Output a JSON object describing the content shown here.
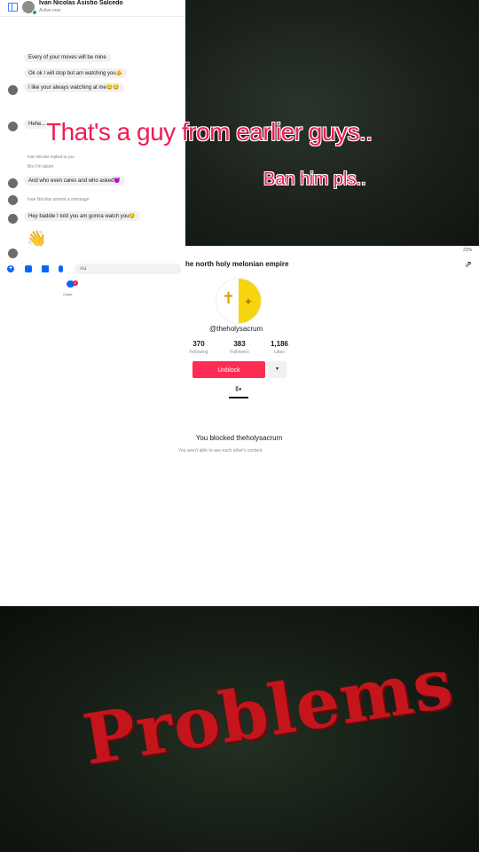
{
  "messenger": {
    "contact_name": "Ivan Nicolas Asistio Salcedo",
    "contact_status": "Active now",
    "messages": [
      "Every of your moves will be mine",
      "Ok ok I will stop but am watching you🫵",
      "I like your always watching at me😏😏",
      "Hehe...",
      "Bro I'm taken",
      "And who even cares and who asked😈",
      "Hey baddie I told you am gonna watch you😏"
    ],
    "reply_label": "Ivan Nicolas replied to you",
    "system_note": "Ivan Nicolas unsent a message",
    "wave": "👋",
    "composer_placeholder": "Aa",
    "chats_label": "Chats",
    "chats_badge": "2"
  },
  "captions": {
    "main": "That's a guy from earlier guys..",
    "sub": "Ban him pls.."
  },
  "profile": {
    "status_bar": "22%",
    "display_name": "he north holy melonian empire",
    "username": "@theholysacrum",
    "stats": [
      {
        "value": "370",
        "label": "Following"
      },
      {
        "value": "383",
        "label": "Followers"
      },
      {
        "value": "1,186",
        "label": "Likes"
      }
    ],
    "unblock_label": "Unblock",
    "more_icon": "▾",
    "videos_tab_icon": "⦀▾",
    "blocked_title": "You blocked theholysacrum",
    "blocked_subtitle": "You aren't able to see each other's content"
  },
  "footer": {
    "title": "Problems"
  },
  "colors": {
    "tiktok_red": "#fe2c55",
    "caption_red": "#ee1d52",
    "problems_red": "#c4151c",
    "messenger_blue": "#0866ff"
  }
}
